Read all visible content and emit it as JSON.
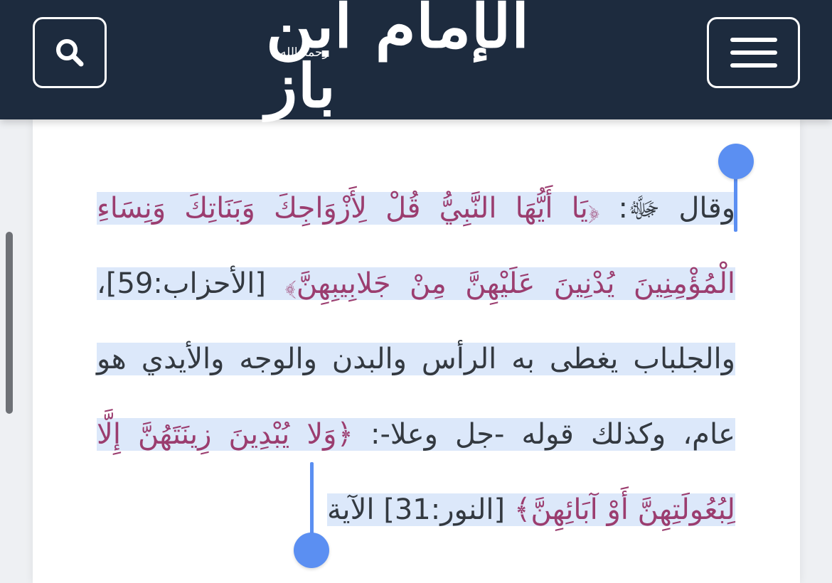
{
  "header": {
    "logo_text": "الإمام ابن باز",
    "logo_sub": "رحمه الله",
    "search_icon": "search-icon",
    "menu_icon": "hamburger-menu-icon"
  },
  "article": {
    "segments": [
      {
        "type": "plain",
        "text": "وقال ﷻ: "
      },
      {
        "type": "quran",
        "text": "﴿يَا أَيُّهَا النَّبِيُّ قُلْ لِأَزْوَاجِكَ وَبَنَاتِكَ وَنِسَاءِ الْمُؤْمِنِينَ يُدْنِينَ عَلَيْهِنَّ مِنْ جَلابِيبِهِنَّ﴾"
      },
      {
        "type": "plain",
        "text": " [الأحزاب:59]، والجلباب يغطى به الرأس والبدن والوجه والأيدي هو عام، وكذلك قوله -جل وعلا-: "
      },
      {
        "type": "quran",
        "text": "﴿وَلا يُبْدِينَ زِينَتَهُنَّ إِلَّا لِبُعُولَتِهِنَّ أَوْ آبَائِهِنَّ﴾"
      },
      {
        "type": "plain",
        "text": " [النور:31] الآية"
      }
    ]
  },
  "colors": {
    "header_bg": "#1d2b3e",
    "quran_text": "#9b3d6f",
    "selection_bg": "#dce8fa",
    "selection_handle": "#5b8ff2"
  }
}
